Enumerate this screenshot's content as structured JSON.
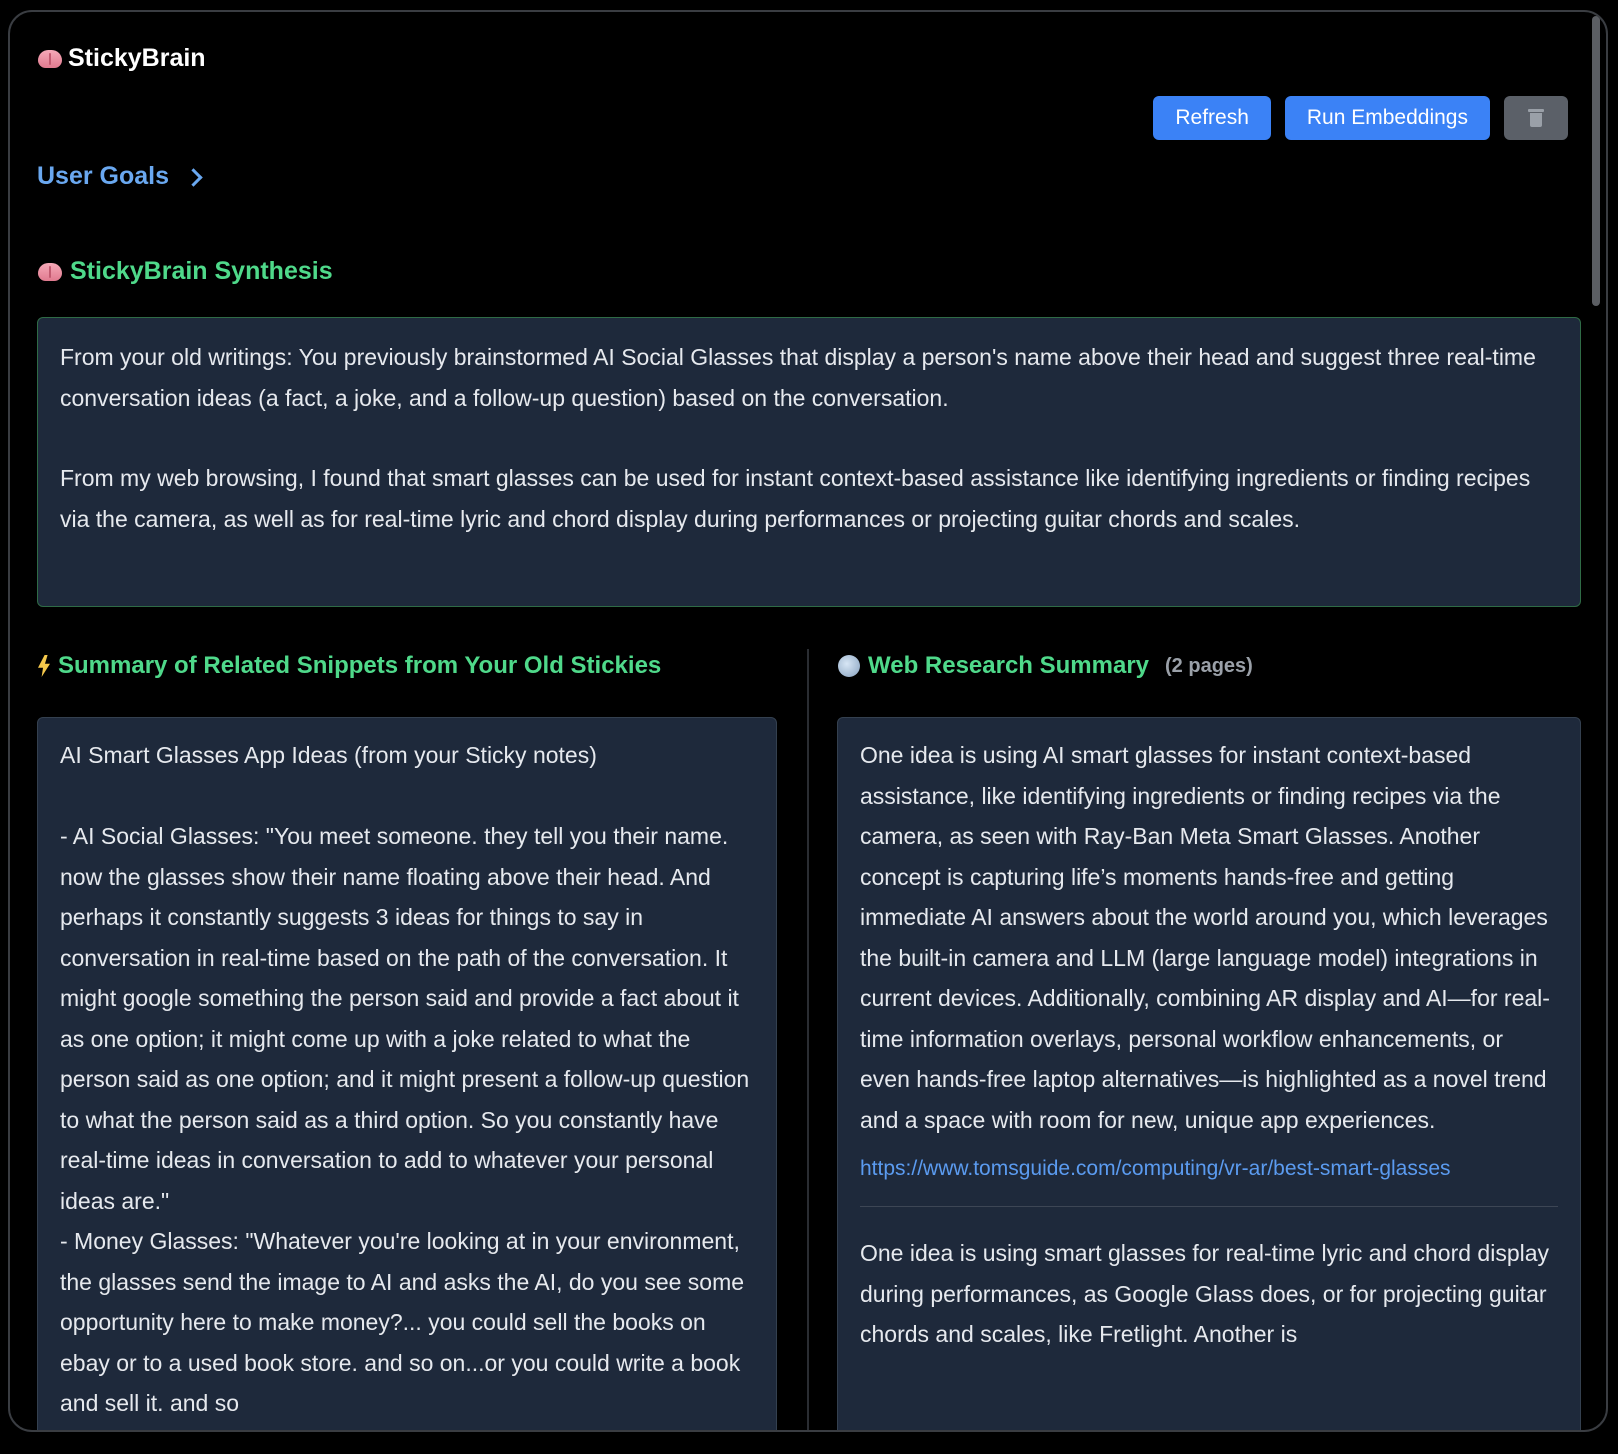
{
  "app": {
    "title": "StickyBrain"
  },
  "toolbar": {
    "refresh_label": "Refresh",
    "run_embeddings_label": "Run Embeddings"
  },
  "goals": {
    "label": "User Goals"
  },
  "synthesis": {
    "title": "StickyBrain Synthesis",
    "paragraphs": [
      "From your old writings: You previously brainstormed AI Social Glasses that display a person's name above their head and suggest three real-time conversation ideas (a fact, a joke, and a follow-up question) based on the conversation.",
      "From my web browsing, I found that smart glasses can be used for instant context-based assistance like identifying ingredients or finding recipes via the camera, as well as for real-time lyric and chord display during performances or projecting guitar chords and scales."
    ]
  },
  "snippets": {
    "title": "Summary of Related Snippets from Your Old Stickies",
    "text": "AI Smart Glasses App Ideas (from your Sticky notes)\n\n- AI Social Glasses: \"You meet someone. they tell you their name. now the glasses show their name floating above their head. And perhaps it constantly suggests 3 ideas for things to say in conversation in real-time based on the path of the conversation. It might google something the person said and provide a fact about it as one option; it might come up with a joke related to what the person said as one option; and it might present a follow-up question to what the person said as a third option. So you constantly have real-time ideas in conversation to add to whatever your personal ideas are.\"\n- Money Glasses: \"Whatever you're looking at in your environment, the glasses send the image to AI and asks the AI, do you see some opportunity here to make money?... you could sell the books on ebay or to a used book store. and so on...or you could write a book and sell it. and so"
  },
  "web_research": {
    "title": "Web Research Summary",
    "pages_count": "(2 pages)",
    "entries": [
      {
        "text": "One idea is using AI smart glasses for instant context-based assistance, like identifying ingredients or finding recipes via the camera, as seen with Ray-Ban Meta Smart Glasses. Another concept is capturing life’s moments hands-free and getting immediate AI answers about the world around you, which leverages the built-in camera and LLM (large language model) integrations in current devices. Additionally, combining AR display and AI—for real-time information overlays, personal workflow enhancements, or even hands-free laptop alternatives—is highlighted as a novel trend and a space with room for new, unique app experiences.",
        "url": "https://www.tomsguide.com/computing/vr-ar/best-smart-glasses"
      },
      {
        "text": "One idea is using smart glasses for real-time lyric and chord display during performances, as Google Glass does, or for projecting guitar chords and scales, like Fretlight. Another is"
      }
    ]
  }
}
